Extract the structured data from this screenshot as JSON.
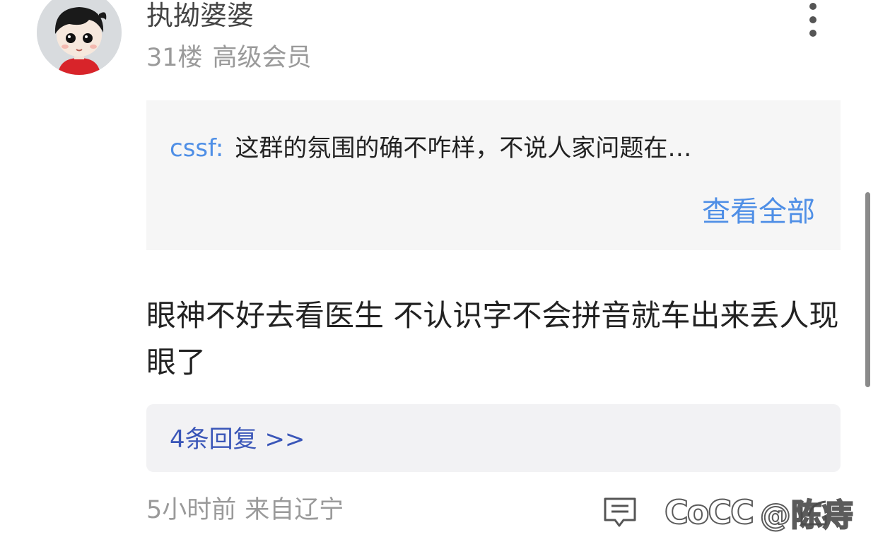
{
  "comment": {
    "username": "执拗婆婆",
    "floor": "31楼",
    "level": "高级会员",
    "quote": {
      "author": "cssf:",
      "text": "这群的氛围的确不咋样，不说人家问题在…",
      "view_all": "查看全部"
    },
    "body": "眼神不好去看医生  不认识字不会拼音就车出来丢人现眼了",
    "replies_link": "4条回复 >>",
    "time": "5小时前",
    "location": "来自辽宁"
  },
  "icons": {
    "more": "more-vertical-icon",
    "reply": "comment-icon",
    "share": "share-icon"
  },
  "watermark": {
    "logo": "CoCC",
    "handle": "@陈痔"
  },
  "colors": {
    "link_blue": "#4f8fe6",
    "reply_link": "#3a56b8",
    "meta_gray": "#9a9a9a",
    "quote_bg": "#f6f6f6",
    "replies_bg": "#f2f2f4"
  }
}
